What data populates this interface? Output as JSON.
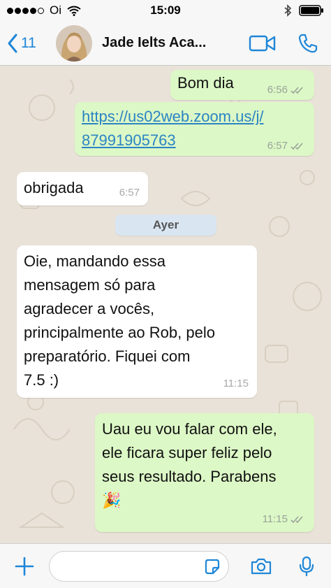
{
  "status_bar": {
    "carrier": "Oi",
    "time": "15:09"
  },
  "header": {
    "back_count": "11",
    "contact_name": "Jade Ielts Aca..."
  },
  "messages": [
    {
      "direction": "out",
      "text": "Bom dia",
      "time": "6:56",
      "ticks": "read"
    },
    {
      "direction": "out",
      "text_line1": "https://us02web.zoom.us/j/",
      "text_line2": "87991905763",
      "time": "6:57",
      "ticks": "read"
    },
    {
      "direction": "in",
      "text": "obrigada",
      "time": "6:57"
    },
    {
      "direction": "in",
      "lines": [
        "Oie, mandando essa",
        "mensagem só para",
        "agradecer a vocês,",
        "principalmente ao Rob, pelo",
        "preparatório. Fiquei com",
        "7.5 :)"
      ],
      "time": "11:15"
    },
    {
      "direction": "out",
      "lines": [
        "Uau eu vou falar com ele,",
        "ele ficara super feliz pelo",
        "seus resultado. Parabens",
        "🎉"
      ],
      "time": "11:15",
      "ticks": "read"
    }
  ],
  "day_separator": "Ayer",
  "colors": {
    "accent": "#1e86d8",
    "outgoing_bubble": "#dcf8c6",
    "incoming_bubble": "#ffffff",
    "wallpaper": "#e9e2d8",
    "link": "#2b84c4"
  },
  "icons": [
    "back-chevron-icon",
    "video-call-icon",
    "phone-icon",
    "plus-icon",
    "sticker-icon",
    "camera-icon",
    "microphone-icon",
    "bluetooth-icon",
    "wifi-icon",
    "battery-icon",
    "read-ticks-icon"
  ]
}
